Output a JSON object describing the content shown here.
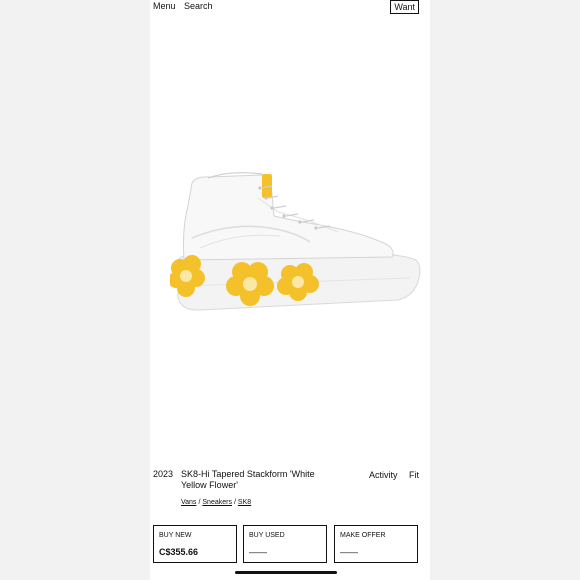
{
  "nav": {
    "menu_label": "Menu",
    "search_label": "Search",
    "want_label": "Want"
  },
  "product": {
    "year": "2023",
    "title": "SK8-Hi Tapered Stackform 'White Yellow Flower'",
    "image_icon": "sneaker-image",
    "colors": {
      "upper": "#f7f7f7",
      "flower": "#f4c12a",
      "flower_center": "#fbe8a4"
    }
  },
  "tabs": {
    "activity_label": "Activity",
    "fit_label": "Fit"
  },
  "breadcrumbs": [
    "Vans",
    "Sneakers",
    "SK8"
  ],
  "breadcrumb_separator": "/",
  "purchase": {
    "buy_new": {
      "label": "BUY NEW",
      "value": "C$355.66"
    },
    "buy_used": {
      "label": "BUY USED",
      "value": "——"
    },
    "make_offer": {
      "label": "MAKE OFFER",
      "value": "——"
    }
  }
}
